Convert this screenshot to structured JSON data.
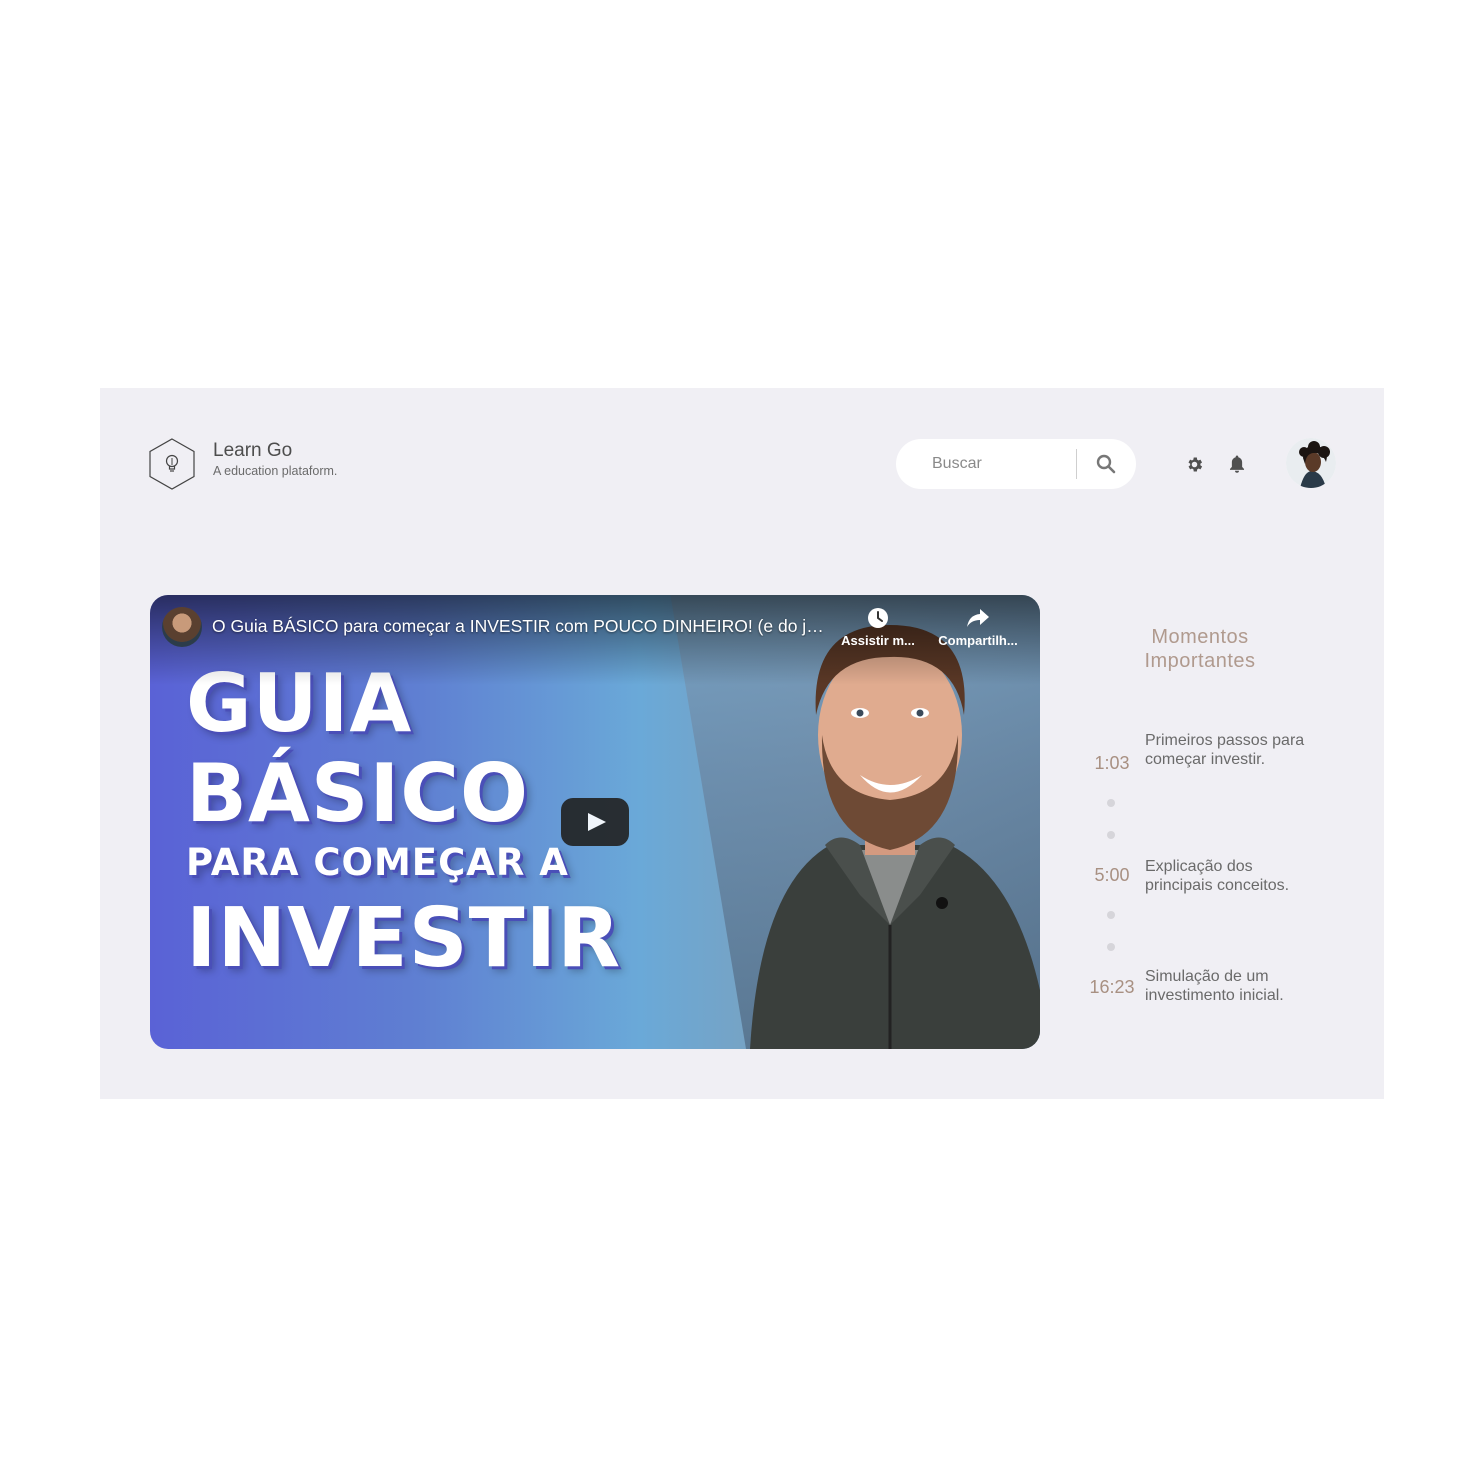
{
  "brand": {
    "title": "Learn Go",
    "subtitle": "A education plataform."
  },
  "search": {
    "placeholder": "Buscar"
  },
  "header_icons": [
    "lightbulb-icon",
    "search-icon",
    "gear-icon",
    "bell-icon"
  ],
  "video": {
    "title": "O Guia BÁSICO para começar a INVESTIR com POUCO DINHEIRO! (e do jeit...",
    "actions": [
      {
        "label": "Assistir m...",
        "icon": "clock-icon"
      },
      {
        "label": "Compartilh...",
        "icon": "share-icon"
      }
    ],
    "thumbnail_text": {
      "line1": "GUIA",
      "line2": "BÁSICO",
      "line3": "PARA COMEÇAR A",
      "line4": "INVESTIR"
    }
  },
  "moments": {
    "title_line1": "Momentos",
    "title_line2": "Importantes",
    "items": [
      {
        "time": "1:03",
        "text": "Primeiros passos para começar investir."
      },
      {
        "time": "5:00",
        "text": "Explicação dos principais conceitos."
      },
      {
        "time": "16:23",
        "text": "Simulação de um investimento inicial."
      }
    ]
  },
  "colors": {
    "app_background": "#f0eff4",
    "accent_moments": "#a89082",
    "text_dark": "#4d4d4d"
  }
}
